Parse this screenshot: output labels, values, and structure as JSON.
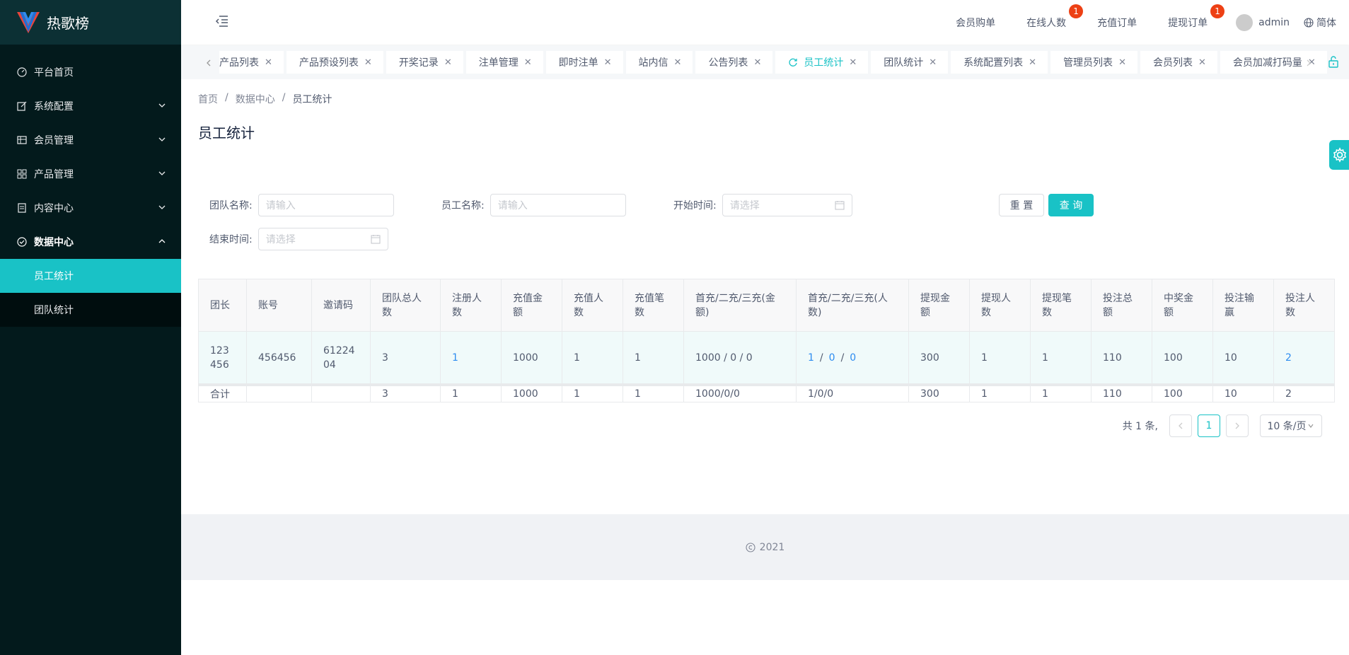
{
  "app": {
    "title": "热歌榜"
  },
  "sidebar": {
    "items": [
      {
        "label": "平台首页",
        "icon": "dashboard-icon"
      },
      {
        "label": "系统配置",
        "icon": "edit-icon"
      },
      {
        "label": "会员管理",
        "icon": "table-icon"
      },
      {
        "label": "产品管理",
        "icon": "grid-icon"
      },
      {
        "label": "内容中心",
        "icon": "document-icon"
      },
      {
        "label": "数据中心",
        "icon": "check-circle-icon"
      }
    ],
    "subitems": [
      {
        "label": "员工统计"
      },
      {
        "label": "团队统计"
      }
    ]
  },
  "header": {
    "links": [
      {
        "label": "会员购单"
      },
      {
        "label": "在线人数",
        "badge": "1"
      },
      {
        "label": "充值订单"
      },
      {
        "label": "提现订单",
        "badge": "1"
      }
    ],
    "user": "admin",
    "lang": "简体"
  },
  "tabs": [
    {
      "label": "产品列表"
    },
    {
      "label": "产品预设列表"
    },
    {
      "label": "开奖记录"
    },
    {
      "label": "注单管理"
    },
    {
      "label": "即时注单"
    },
    {
      "label": "站内信"
    },
    {
      "label": "公告列表"
    },
    {
      "label": "员工统计",
      "active": true
    },
    {
      "label": "团队统计"
    },
    {
      "label": "系统配置列表"
    },
    {
      "label": "管理员列表"
    },
    {
      "label": "会员列表"
    },
    {
      "label": "会员加减打码量"
    }
  ],
  "breadcrumb": {
    "home": "首页",
    "parent": "数据中心",
    "current": "员工统计"
  },
  "page": {
    "title": "员工统计"
  },
  "form": {
    "team_label": "团队名称:",
    "team_placeholder": "请输入",
    "staff_label": "员工名称:",
    "staff_placeholder": "请输入",
    "start_label": "开始时间:",
    "start_placeholder": "请选择",
    "end_label": "结束时间:",
    "end_placeholder": "请选择",
    "reset": "重 置",
    "query": "查 询"
  },
  "table": {
    "headers": [
      "团长",
      "账号",
      "邀请码",
      "团队总人数",
      "注册人数",
      "充值金额",
      "充值人数",
      "充值笔数",
      "首充/二充/三充(金额)",
      "首充/二充/三充(人数)",
      "提现金额",
      "提现人数",
      "提现笔数",
      "投注总额",
      "中奖金额",
      "投注输赢",
      "投注人数"
    ],
    "row": {
      "leader": "123456",
      "account": "456456",
      "invite": "6122404",
      "team_total": "3",
      "register": "1",
      "recharge_amount": "1000",
      "recharge_people": "1",
      "recharge_count": "1",
      "first_amount": "1000 / 0 / 0",
      "first_people_1": "1",
      "first_people_2": "0",
      "first_people_3": "0",
      "withdraw_amount": "300",
      "withdraw_people": "1",
      "withdraw_count": "1",
      "bet_total": "110",
      "win_amount": "100",
      "bet_profit": "10",
      "bet_people": "2"
    },
    "summary": {
      "label": "合计",
      "team_total": "3",
      "register": "1",
      "recharge_amount": "1000",
      "recharge_people": "1",
      "recharge_count": "1",
      "first_amount": "1000/0/0",
      "first_people": "1/0/0",
      "withdraw_amount": "300",
      "withdraw_people": "1",
      "withdraw_count": "1",
      "bet_total": "110",
      "win_amount": "100",
      "bet_profit": "10",
      "bet_people": "2"
    }
  },
  "pagination": {
    "total": "共 1 条,",
    "current": "1",
    "page_size": "10 条/页"
  },
  "footer": {
    "copyright": "2021"
  },
  "colors": {
    "accent": "#19c2c6",
    "sidebar_bg": "#031a1c",
    "badge": "#ed4014"
  }
}
